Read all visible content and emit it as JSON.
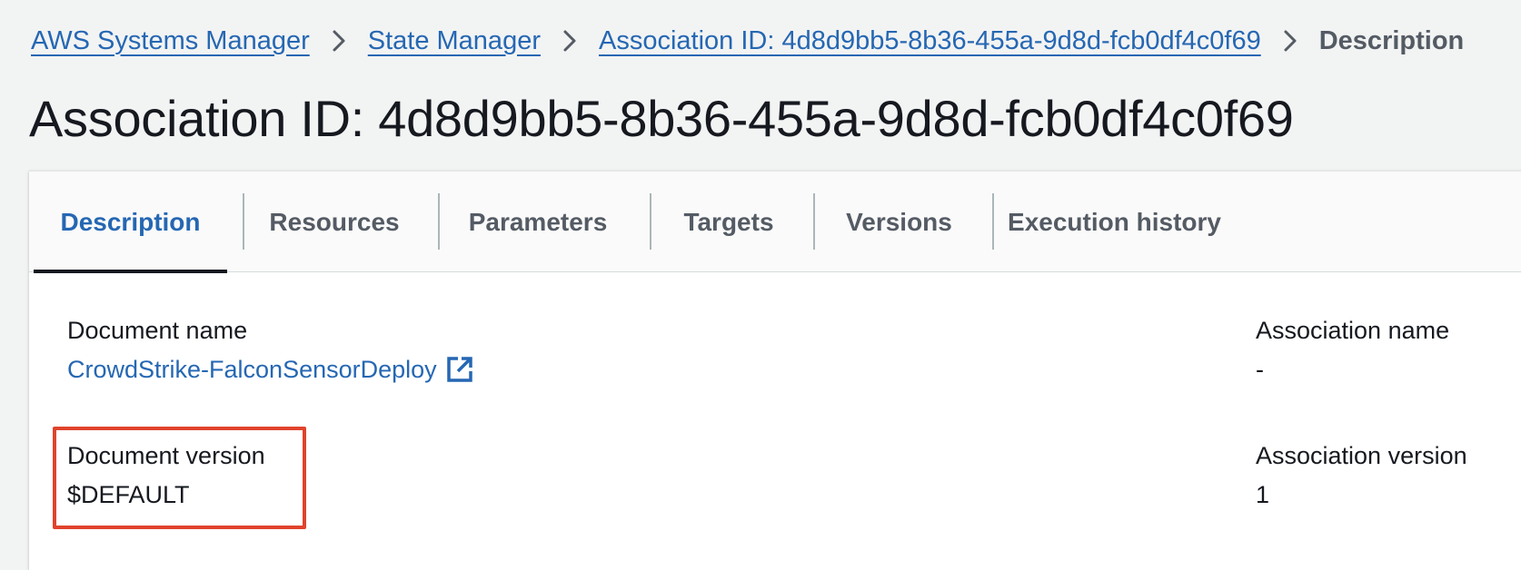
{
  "breadcrumb": {
    "items": [
      {
        "label": "AWS Systems Manager"
      },
      {
        "label": "State Manager"
      },
      {
        "label": "Association ID: 4d8d9bb5-8b36-455a-9d8d-fcb0df4c0f69"
      }
    ],
    "current": "Description"
  },
  "page": {
    "title": "Association ID: 4d8d9bb5-8b36-455a-9d8d-fcb0df4c0f69"
  },
  "tabs": [
    {
      "label": "Description",
      "active": true
    },
    {
      "label": "Resources"
    },
    {
      "label": "Parameters"
    },
    {
      "label": "Targets"
    },
    {
      "label": "Versions"
    },
    {
      "label": "Execution history"
    }
  ],
  "details": {
    "document_name_label": "Document name",
    "document_name_value": "CrowdStrike-FalconSensorDeploy",
    "document_version_label": "Document version",
    "document_version_value": "$DEFAULT",
    "association_name_label": "Association name",
    "association_name_value": "-",
    "association_version_label": "Association version",
    "association_version_value": "1"
  },
  "icons": {
    "breadcrumb_separator": "chevron-right-icon",
    "document_link": "external-link-icon"
  },
  "colors": {
    "link": "#2567b3",
    "highlight": "#e0432c",
    "active_tab_underline": "#16191f"
  }
}
